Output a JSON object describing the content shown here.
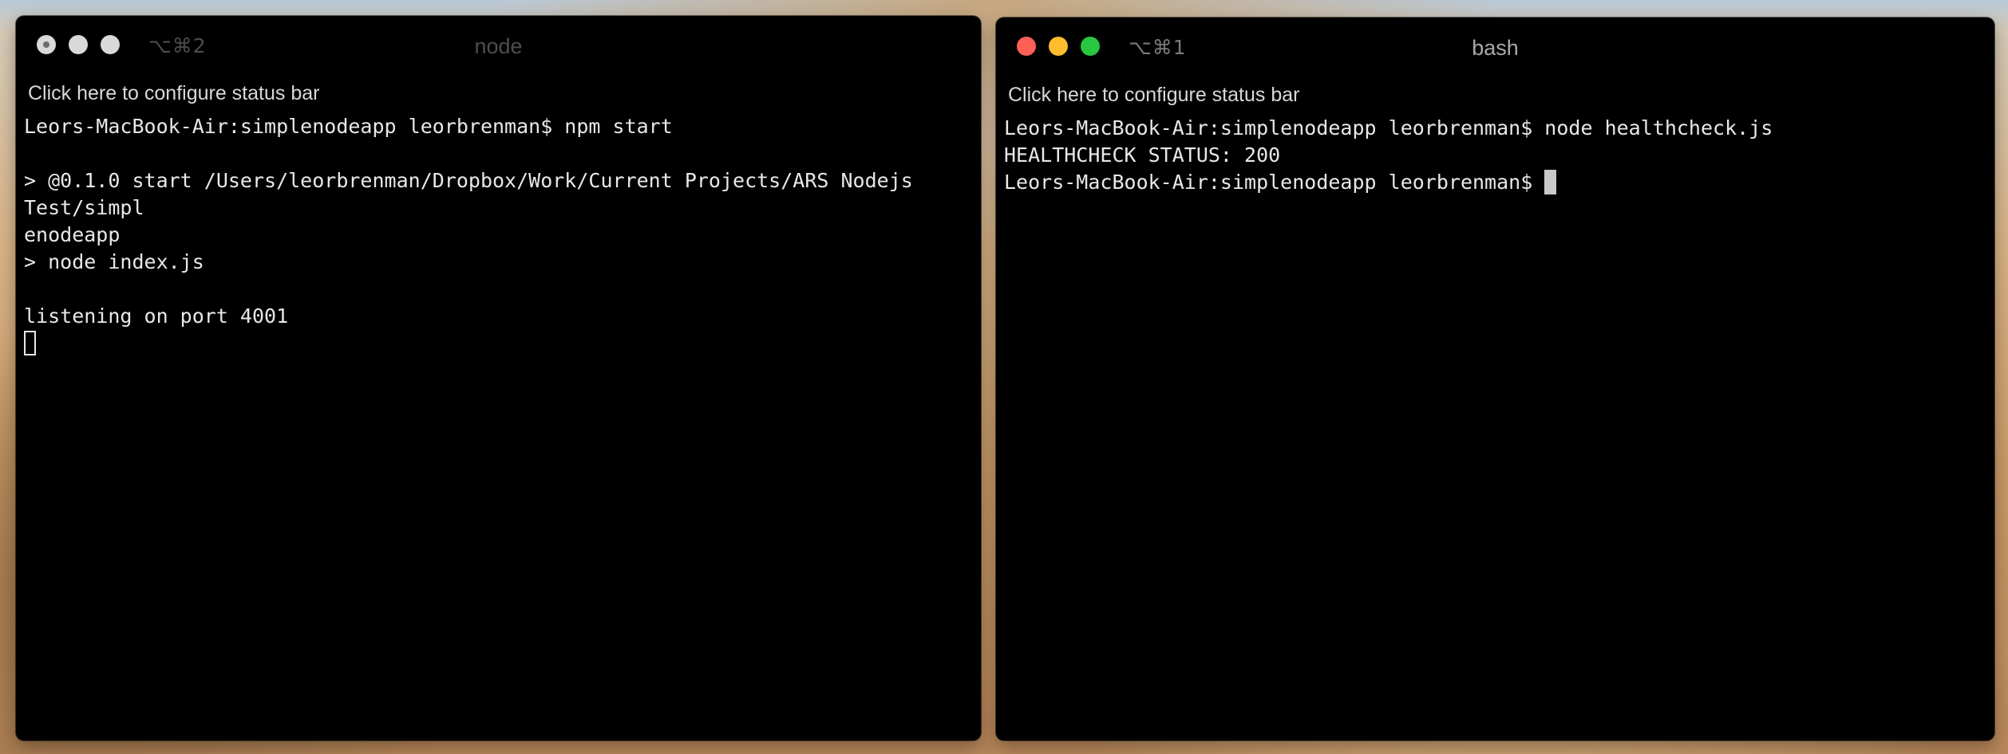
{
  "windows": {
    "node": {
      "shortcut": "⌥⌘2",
      "title": "node",
      "status_bar": "Click here to configure status bar",
      "lines": [
        "Leors-MacBook-Air:simplenodeapp leorbrenman$ npm start",
        "",
        "> @0.1.0 start /Users/leorbrenman/Dropbox/Work/Current Projects/ARS Nodejs Test/simpl",
        "enodeapp",
        "> node index.js",
        "",
        "listening on port 4001"
      ]
    },
    "bash": {
      "shortcut": "⌥⌘1",
      "title": "bash",
      "status_bar": "Click here to configure status bar",
      "lines": [
        "Leors-MacBook-Air:simplenodeapp leorbrenman$ node healthcheck.js",
        "HEALTHCHECK STATUS: 200"
      ],
      "prompt": "Leors-MacBook-Air:simplenodeapp leorbrenman$ "
    }
  },
  "colors": {
    "close": "#fe5f57",
    "minimize": "#febc2e",
    "maximize": "#28c840",
    "terminal_bg": "#000000",
    "terminal_fg": "#e8e8e8"
  }
}
